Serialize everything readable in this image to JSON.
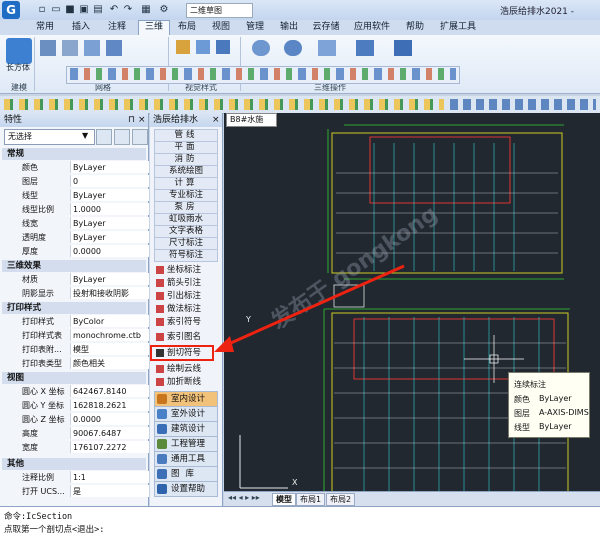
{
  "app": {
    "logo_letter": "G",
    "drawing_name": "二维草图",
    "title": "浩辰给排水2021 -"
  },
  "ribbon": {
    "tabs": [
      "常用",
      "插入",
      "注释",
      "三维",
      "布局",
      "视图",
      "管理",
      "输出",
      "云存储",
      "应用软件",
      "帮助",
      "扩展工具"
    ],
    "active_tab": "三维",
    "big_button_label": "长方体",
    "group_labels": [
      "建模",
      "网格",
      "视觉样式",
      "三维操作"
    ]
  },
  "properties": {
    "header": "特性",
    "selection": "无选择",
    "sections": {
      "general": {
        "title": "常规",
        "rows": [
          {
            "name": "颜色",
            "value": "ByLayer"
          },
          {
            "name": "图层",
            "value": "0"
          },
          {
            "name": "线型",
            "value": "ByLayer"
          },
          {
            "name": "线型比例",
            "value": "1.0000"
          },
          {
            "name": "线宽",
            "value": "ByLayer"
          },
          {
            "name": "透明度",
            "value": "ByLayer"
          },
          {
            "name": "厚度",
            "value": "0.0000"
          }
        ]
      },
      "threed": {
        "title": "三维效果",
        "rows": [
          {
            "name": "材质",
            "value": "ByLayer"
          },
          {
            "name": "阴影显示",
            "value": "投射和接收阴影"
          }
        ]
      },
      "print": {
        "title": "打印样式",
        "rows": [
          {
            "name": "打印样式",
            "value": "ByColor"
          },
          {
            "name": "打印样式表",
            "value": "monochrome.ctb"
          },
          {
            "name": "打印表附...",
            "value": "模型"
          },
          {
            "name": "打印表类型",
            "value": "颜色相关"
          }
        ]
      },
      "view": {
        "title": "视图",
        "rows": [
          {
            "name": "圆心 X 坐标",
            "value": "642467.8140"
          },
          {
            "name": "圆心 Y 坐标",
            "value": "162818.2621"
          },
          {
            "name": "圆心 Z 坐标",
            "value": "0.0000"
          },
          {
            "name": "高度",
            "value": "90067.6487"
          },
          {
            "name": "宽度",
            "value": "176107.2272"
          }
        ]
      },
      "other": {
        "title": "其他",
        "rows": [
          {
            "name": "注释比例",
            "value": "1:1"
          },
          {
            "name": "打开 UCS...",
            "value": "是"
          }
        ]
      }
    }
  },
  "panel": {
    "header": "浩辰给排水",
    "categories": [
      "管线",
      "平面",
      "消防",
      "系统绘图",
      "计算",
      "专业标注",
      "泵房",
      "虹吸雨水",
      "文字表格",
      "尺寸标注",
      "符号标注"
    ],
    "commands": [
      "坐标标注",
      "箭头引注",
      "引出标注",
      "做法标注",
      "索引符号",
      "索引图名",
      "剖切符号",
      "绘制云线",
      "加折断线"
    ],
    "highlighted_command": "剖切符号",
    "bottom": [
      "室内设计",
      "室外设计",
      "建筑设计",
      "工程管理",
      "通用工具",
      "图库",
      "设置帮助"
    ]
  },
  "drawing": {
    "doc_tab": "B8#水施",
    "layout_tabs": [
      "模型",
      "布局1",
      "布局2"
    ],
    "watermark": "发布于 gongkong",
    "tooltip": {
      "title": "连续标注",
      "rows": [
        {
          "name": "颜色",
          "value": "ByLayer"
        },
        {
          "name": "图层",
          "value": "A-AXIS-DIMS"
        },
        {
          "name": "线型",
          "value": "ByLayer"
        }
      ]
    }
  },
  "command_line": {
    "line1": "命令:IcSection",
    "line2": "点取第一个剖切点<退出>:"
  }
}
